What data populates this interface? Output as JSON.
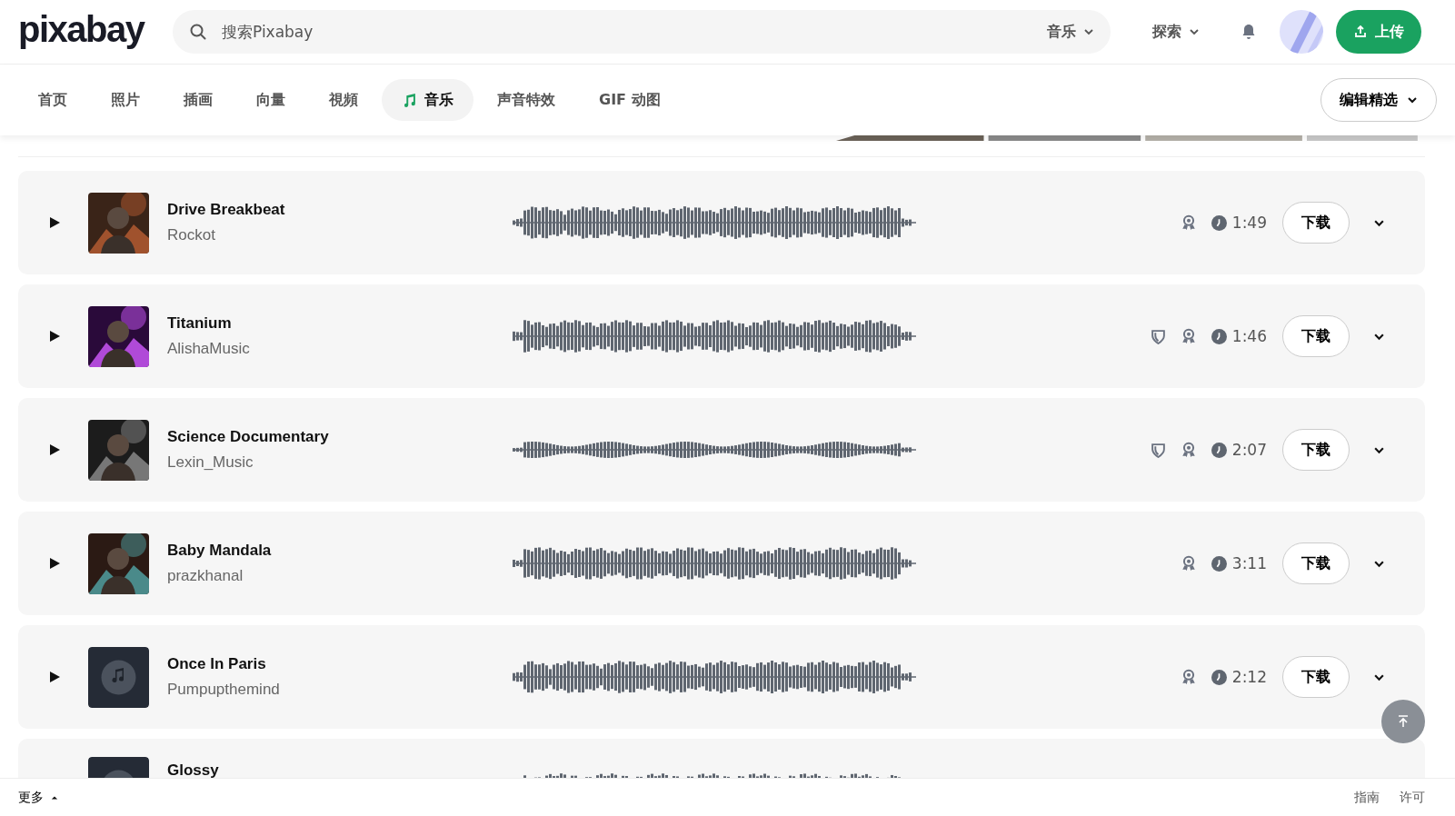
{
  "header": {
    "logo": "pixabay",
    "search": {
      "placeholder": "搜索Pixabay",
      "scope": "音乐"
    },
    "explore": "探索",
    "upload": "上传"
  },
  "nav": {
    "tabs": [
      {
        "label": "首页",
        "selected": false,
        "kind": "text"
      },
      {
        "label": "照片",
        "selected": false,
        "kind": "text"
      },
      {
        "label": "插画",
        "selected": false,
        "kind": "text"
      },
      {
        "label": "向量",
        "selected": false,
        "kind": "text"
      },
      {
        "label": "視頻",
        "selected": false,
        "kind": "text"
      },
      {
        "label": "音乐",
        "selected": true,
        "kind": "music"
      },
      {
        "label": "声音特效",
        "selected": false,
        "kind": "text"
      },
      {
        "label": "GIF 动图",
        "selected": false,
        "kind": "text"
      }
    ],
    "sort": "编辑精选"
  },
  "tracks": [
    {
      "title": "Drive Breakbeat",
      "artist": "Rockot",
      "shield": false,
      "duration": "1:49",
      "download": "下载",
      "kind": "picture"
    },
    {
      "title": "Titanium",
      "artist": "AlishaMusic",
      "shield": true,
      "duration": "1:46",
      "download": "下载",
      "kind": "picture"
    },
    {
      "title": "Science Documentary",
      "artist": "Lexin_Music",
      "shield": true,
      "duration": "2:07",
      "download": "下载",
      "kind": "picture"
    },
    {
      "title": "Baby Mandala",
      "artist": "prazkhanal",
      "shield": false,
      "duration": "3:11",
      "download": "下载",
      "kind": "picture"
    },
    {
      "title": "Once In Paris",
      "artist": "Pumpupthemind",
      "shield": false,
      "duration": "2:12",
      "download": "下载",
      "kind": "note"
    },
    {
      "title": "Glossy",
      "kind": "note"
    }
  ],
  "footer": {
    "more": "更多",
    "links": [
      "指南",
      "许可"
    ]
  }
}
